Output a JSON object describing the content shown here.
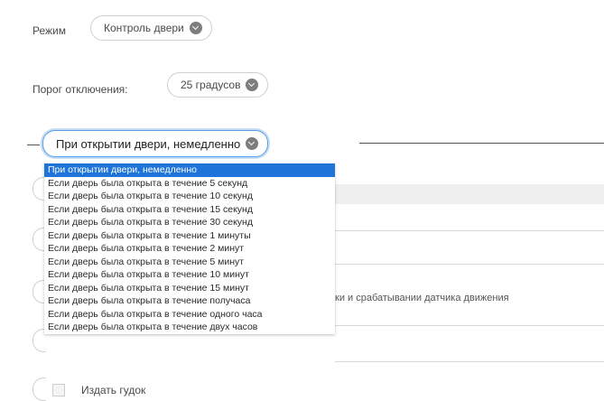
{
  "mode": {
    "label": "Режим",
    "value": "Контроль двери"
  },
  "delay": {
    "label": "Порог отключения:",
    "value": "25 градусов"
  },
  "select": {
    "value": "При открытии двери, немедленно",
    "options": [
      "При открытии двери, немедленно",
      "Если дверь была открыта в течение 5 секунд",
      "Если дверь была открыта в течение 10 секунд",
      "Если дверь была открыта в течение 15 секунд",
      "Если дверь была открыта в течение 30 секунд",
      "Если дверь была открыта в течение 1 минуты",
      "Если дверь была открыта в течение 2 минут",
      "Если дверь была открыта в течение 5 минут",
      "Если дверь была открыта в течение 10 минут",
      "Если дверь была открыта в течение 15 минут",
      "Если дверь была открыта в течение получаса",
      "Если дверь была открыта в течение одного часа",
      "Если дверь была открыта в течение двух часов"
    ]
  },
  "behind_text": "ки и срабатывании датчика движения",
  "checkbox_label": "Издать гудок"
}
